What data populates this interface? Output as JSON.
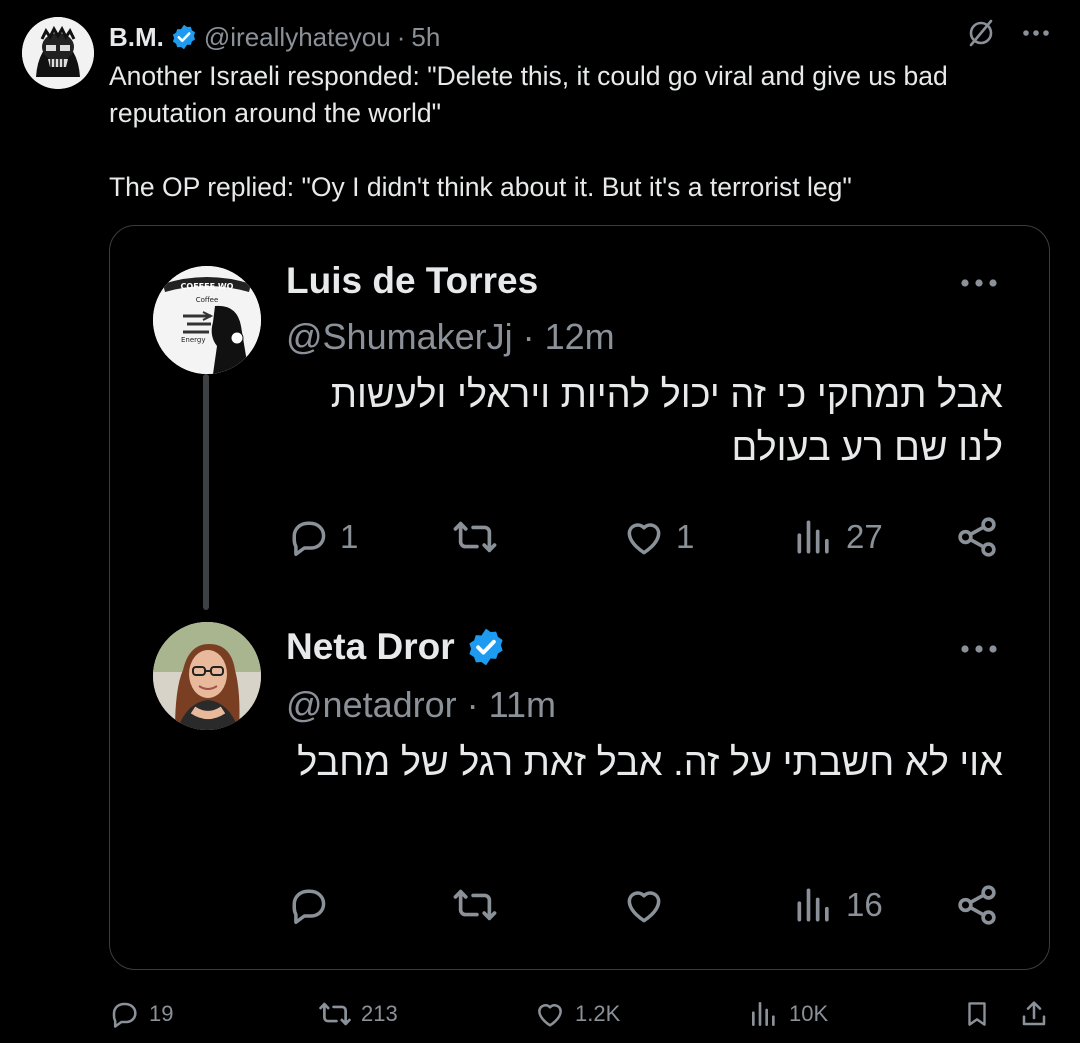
{
  "post": {
    "author_name": "B.M.",
    "handle": "@ireallyhateyou",
    "separator": "·",
    "time": "5h",
    "text": "Another Israeli responded: \"Delete this, it could go viral and give us bad reputation around the world\"\n\nThe OP replied: \"Oy I didn't think about it. But it's a terrorist leg\""
  },
  "quote": {
    "tweets": [
      {
        "author_name": "Luis de Torres",
        "handle": "@ShumakerJj",
        "time": "12m",
        "text": "אבל תמחקי כי זה יכול להיות ויראלי ולעשות לנו שם רע בעולם",
        "replies": "1",
        "retweets": "",
        "likes": "1",
        "views": "27"
      },
      {
        "author_name": "Neta Dror",
        "handle": "@netadror",
        "time": "11m",
        "text": "אוי לא חשבתי על זה. אבל זאת רגל של מחבל",
        "replies": "",
        "retweets": "",
        "likes": "",
        "views": "16"
      }
    ]
  },
  "stats": {
    "replies": "19",
    "retweets": "213",
    "likes": "1.2K",
    "views": "10K"
  },
  "colors": {
    "background": "#000000",
    "text": "#e7e9ea",
    "secondary": "#8b9198",
    "verified": "#1d9bf0",
    "border": "#3a3d41"
  }
}
